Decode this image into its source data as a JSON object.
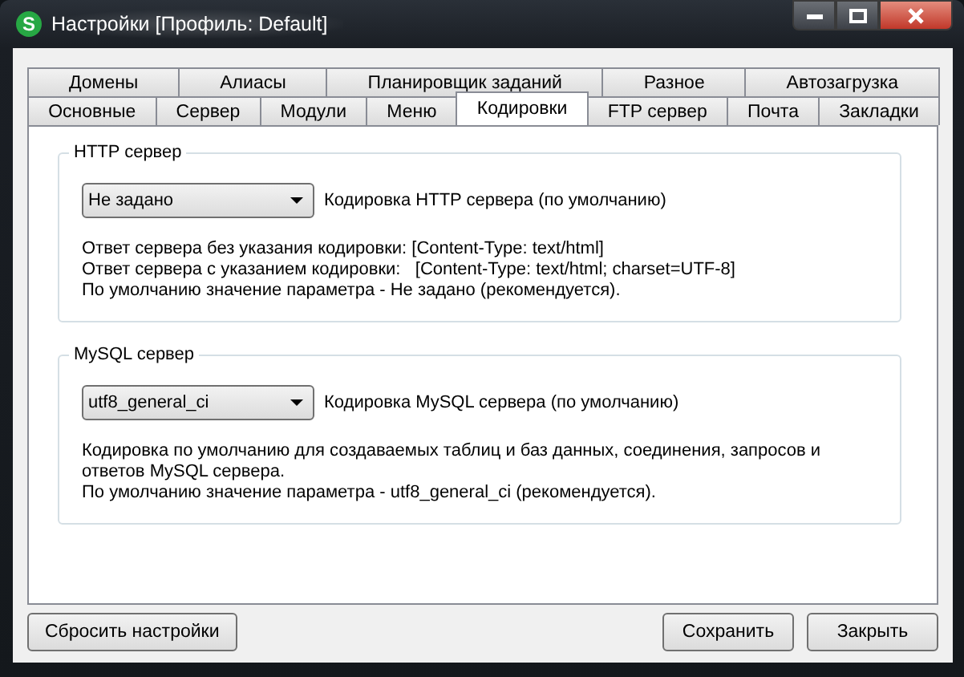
{
  "window": {
    "title": "Настройки [Профиль: Default]",
    "icon_letter": "S"
  },
  "tab_rows": [
    [
      {
        "label": "Домены",
        "selected": false
      },
      {
        "label": "Алиасы",
        "selected": false
      },
      {
        "label": "Планировщик заданий",
        "selected": false
      },
      {
        "label": "Разное",
        "selected": false
      },
      {
        "label": "Автозагрузка",
        "selected": false
      }
    ],
    [
      {
        "label": "Основные",
        "selected": false
      },
      {
        "label": "Сервер",
        "selected": false
      },
      {
        "label": "Модули",
        "selected": false
      },
      {
        "label": "Меню",
        "selected": false
      },
      {
        "label": "Кодировки",
        "selected": true
      },
      {
        "label": "FTP сервер",
        "selected": false
      },
      {
        "label": "Почта",
        "selected": false
      },
      {
        "label": "Закладки",
        "selected": false
      }
    ]
  ],
  "groups": [
    {
      "title": "HTTP сервер",
      "select_value": "Не задано",
      "select_label": "Кодировка HTTP сервера (по умолчанию)",
      "lines": [
        "Ответ сервера без указания кодировки: [Content-Type: text/html]",
        "Ответ сервера с указанием кодировки:   [Content-Type: text/html; charset=UTF-8]",
        "По умолчанию значение параметра - Не задано (рекомендуется)."
      ]
    },
    {
      "title": "MySQL сервер",
      "select_value": "utf8_general_ci",
      "select_label": "Кодировка MySQL сервера (по умолчанию)",
      "lines": [
        "Кодировка по умолчанию для создаваемых таблиц и баз данных, соединения, запросов и ответов MySQL сервера.",
        "По умолчанию значение параметра - utf8_general_ci (рекомендуется)."
      ]
    }
  ],
  "buttons_left": [
    "Сбросить настройки"
  ],
  "buttons_right": [
    "Сохранить",
    "Закрыть"
  ]
}
